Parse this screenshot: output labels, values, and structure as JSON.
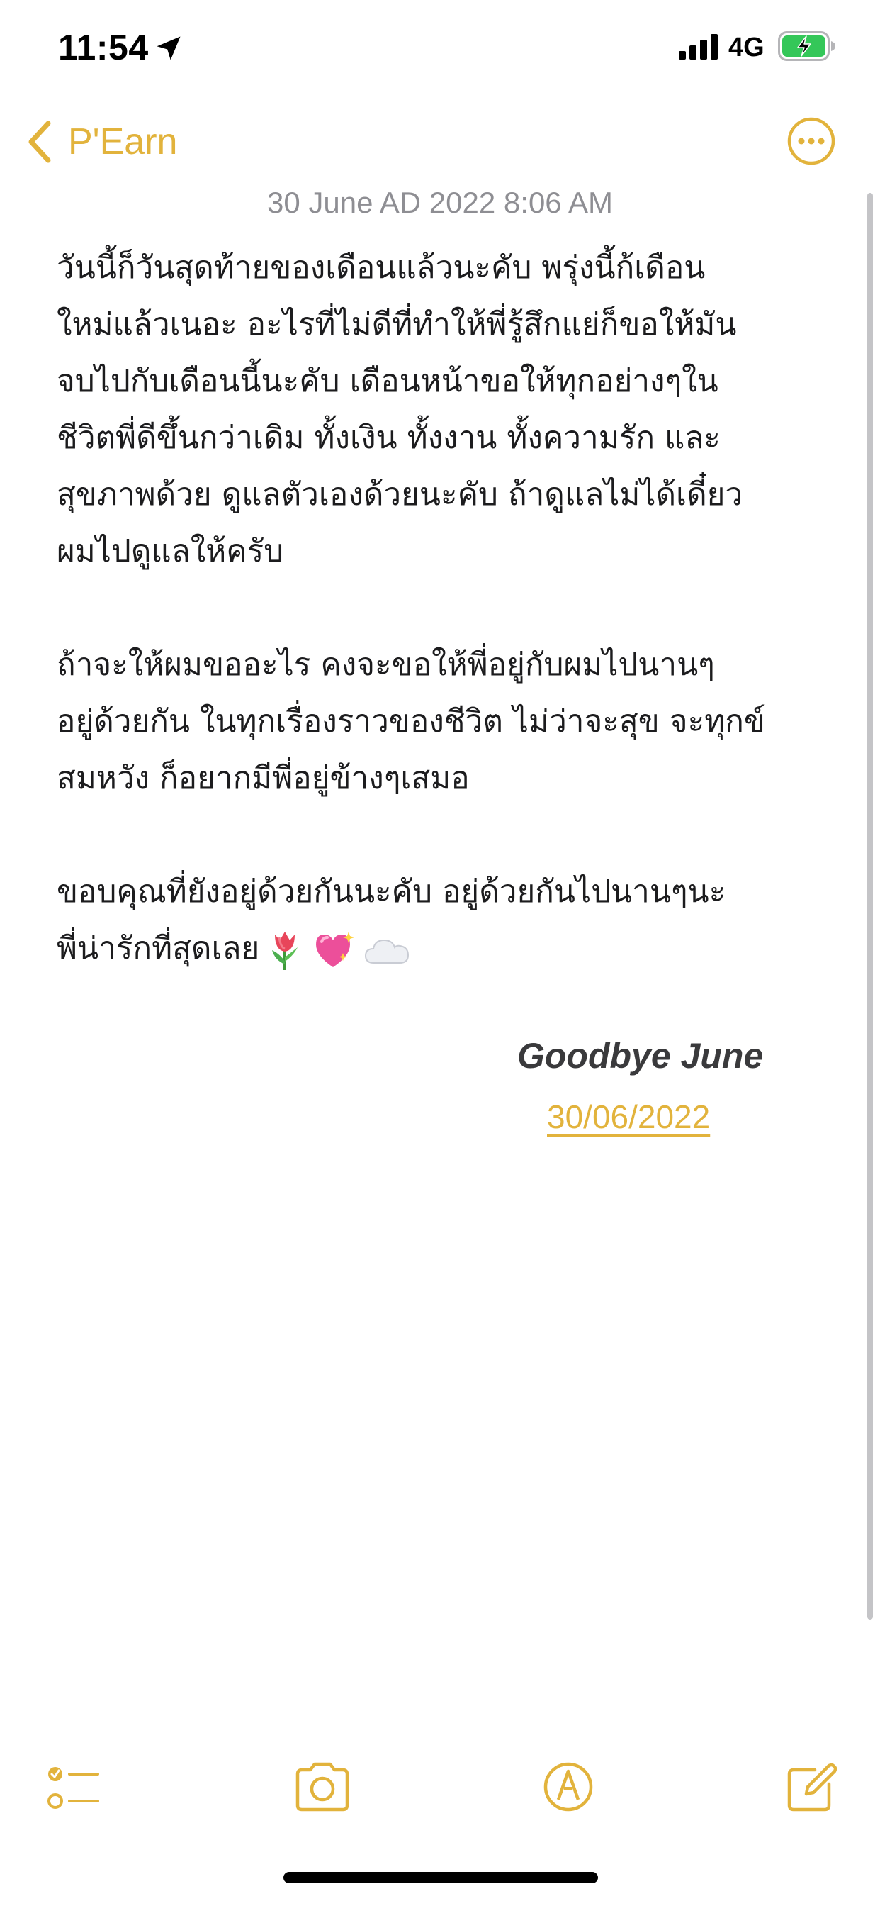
{
  "status_bar": {
    "time": "11:54",
    "network": "4G"
  },
  "nav": {
    "back_label": "P'Earn"
  },
  "note": {
    "date": "30 June AD 2022 8:06 AM",
    "paragraphs": [
      "วันนี้ก็วันสุดท้ายของเดือนแล้วนะคับ พรุ่งนี้ก้เดือน\nใหม่แล้วเนอะ อะไรที่ไม่ดีที่ทำให้พี่รู้สึกแย่ก็ขอให้มัน\nจบไปกับเดือนนี้นะคับ เดือนหน้าขอให้ทุกอย่างๆใน\nชีวิตพี่ดีขึ้นกว่าเดิม ทั้งเงิน ทั้งงาน ทั้งความรัก และ\nสุขภาพด้วย ดูแลตัวเองด้วยนะคับ ถ้าดูแลไม่ได้เดี๋ยว\nผมไปดูแลให้ครับ",
      "ถ้าจะให้ผมขออะไร คงจะขอให้พี่อยู่กับผมไปนานๆ\nอยู่ด้วยกัน ในทุกเรื่องราวของชีวิต ไม่ว่าจะสุข จะทุกข์\nสมหวัง ก็อยากมีพี่อยู่ข้างๆเสมอ",
      "ขอบคุณที่ยังอยู่ด้วยกันนะคับ อยู่ด้วยกันไปนานๆนะ\nพี่น่ารักที่สุดเลย"
    ],
    "emojis": [
      "tulip-emoji",
      "sparkling-heart-emoji",
      "cloud-emoji"
    ],
    "signature": "Goodbye June",
    "signature_date": "30/06/2022"
  },
  "colors": {
    "accent": "#e2b33c",
    "text": "#1c1c1e",
    "secondary": "#8e8e93",
    "battery_fill": "#34c759"
  },
  "toolbar": {
    "icons": [
      "checklist-icon",
      "camera-icon",
      "markup-pen-icon",
      "compose-icon"
    ]
  }
}
